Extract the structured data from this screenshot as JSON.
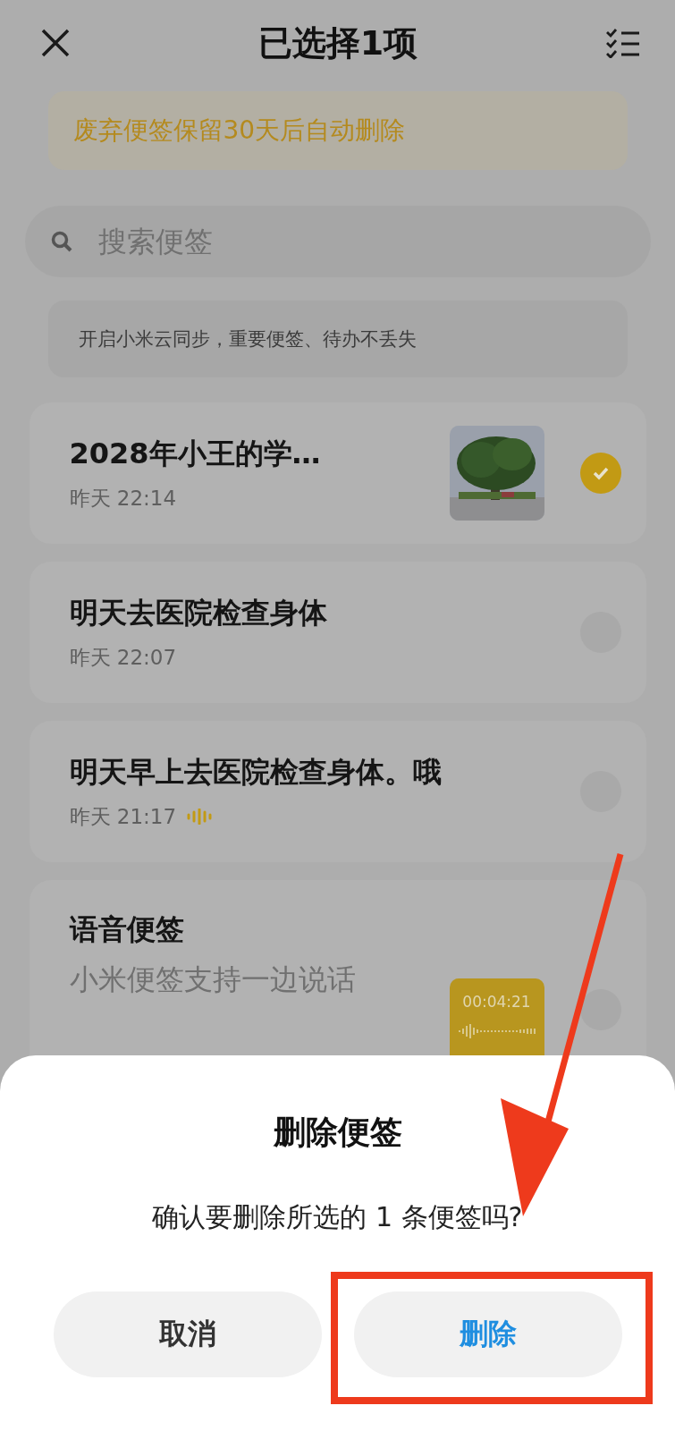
{
  "header": {
    "title": "已选择1项"
  },
  "banner": {
    "text": "废弃便签保留30天后自动删除"
  },
  "search": {
    "placeholder": "搜索便签"
  },
  "sync_tip": {
    "text": "开启小米云同步，重要便签、待办不丢失"
  },
  "notes": [
    {
      "title": "2028年小王的学…",
      "time": "昨天 22:14",
      "selected": true,
      "has_audio": false
    },
    {
      "kind": "plain",
      "title": "明天去医院检查身体",
      "time": "昨天 22:07",
      "selected": false,
      "has_audio": false
    },
    {
      "kind": "plain",
      "title": "明天早上去医院检查身体。哦",
      "time": "昨天 21:17",
      "selected": false,
      "has_audio": true
    },
    {
      "kind": "voice",
      "title": "语音便签",
      "preview": [
        "小米便签支持一边说话"
      ],
      "duration": "00:04:21",
      "selected": false
    }
  ],
  "dialog": {
    "title": "删除便签",
    "message": "确认要删除所选的 1 条便签吗?",
    "buttons": [
      {
        "label": "取消",
        "kind": "cancel"
      },
      {
        "label": "删除",
        "kind": "confirm"
      }
    ]
  }
}
